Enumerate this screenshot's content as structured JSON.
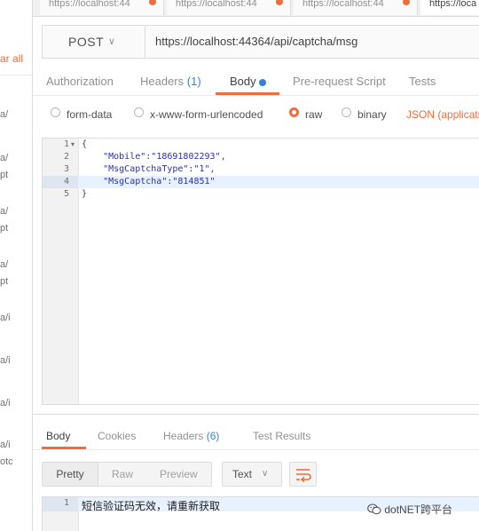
{
  "sidebar": {
    "clear_all": "ar all",
    "fragments": [
      "a/",
      "a/",
      "pt",
      "a/",
      "pt",
      "a/",
      "pt",
      "a/i",
      "a/i",
      "a/i",
      "a/i",
      "otc"
    ]
  },
  "tabs": [
    {
      "label": "https://localhost:44"
    },
    {
      "label": "https://localhost:44"
    },
    {
      "label": "https://localhost:44"
    },
    {
      "label": "https://loca"
    }
  ],
  "request": {
    "method": "POST",
    "url": "https://localhost:44364/api/captcha/msg"
  },
  "request_tabs": {
    "authorization": "Authorization",
    "headers": "Headers",
    "headers_count": "(1)",
    "body": "Body",
    "pre_request": "Pre-request Script",
    "tests": "Tests"
  },
  "body_options": {
    "form_data": "form-data",
    "urlencoded": "x-www-form-urlencoded",
    "raw": "raw",
    "binary": "binary",
    "content_type": "JSON (applicatio"
  },
  "editor": {
    "line_numbers": [
      "1",
      "2",
      "3",
      "4",
      "5"
    ],
    "line1": "{",
    "key2": "\"Mobile\"",
    "val2": "\"18691802293\"",
    "key3": "\"MsgCaptchaType\"",
    "val3": "\"1\"",
    "key4": "\"MsgCaptcha\"",
    "val4": "\"814851\"",
    "line5": "}"
  },
  "response": {
    "tabs": {
      "body": "Body",
      "cookies": "Cookies",
      "headers": "Headers",
      "headers_count": "(6)",
      "test_results": "Test Results"
    },
    "views": {
      "pretty": "Pretty",
      "raw": "Raw",
      "preview": "Preview"
    },
    "format": "Text",
    "line_number": "1",
    "text": "短信验证码无效，请重新获取"
  },
  "watermark": "dotNET跨平台",
  "colors": {
    "accent": "#f26b3a",
    "blue": "#3a7dd8",
    "string": "#2b2fb0"
  }
}
